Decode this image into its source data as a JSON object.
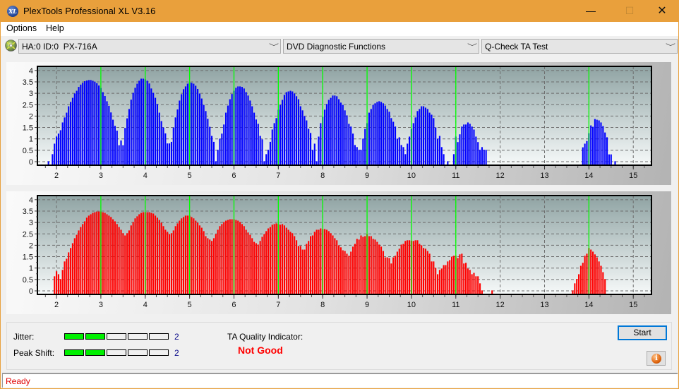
{
  "window": {
    "title": "PlexTools Professional XL V3.16",
    "icon_text": "XL",
    "controls": {
      "minimize": "—",
      "maximize": "☐",
      "close": "✕"
    }
  },
  "menu": [
    {
      "label": "Options"
    },
    {
      "label": "Help"
    }
  ],
  "toolbar": {
    "drive": "HA:0 ID:0  PX-716A",
    "function": "DVD Diagnostic Functions",
    "test": "Q-Check TA Test",
    "chevron": "﹀"
  },
  "chart_data": [
    {
      "type": "bar",
      "title": "",
      "color": "#0000ff",
      "marker_color": "#00ff00",
      "xlim": [
        1.57,
        15.41
      ],
      "ylim": [
        -0.155,
        4.18
      ],
      "x_ticks": [
        2,
        3,
        4,
        5,
        6,
        7,
        8,
        9,
        10,
        11,
        12,
        13,
        14,
        15
      ],
      "x_minor_step": 0.25,
      "y_ticks": [
        0,
        0.5,
        1,
        1.5,
        2,
        2.5,
        3,
        3.5,
        4
      ],
      "grid": true,
      "marker_x": [
        3,
        4,
        5,
        6,
        7,
        8,
        9,
        10,
        11,
        14
      ],
      "x_start": 1.8182,
      "x_step": 0.04545,
      "values": [
        0.02,
        0,
        0.33,
        0.79,
        1.1,
        1.23,
        1.38,
        1.72,
        1.94,
        2.15,
        2.43,
        2.62,
        2.8,
        2.99,
        3.11,
        3.28,
        3.38,
        3.46,
        3.53,
        3.56,
        3.58,
        3.58,
        3.55,
        3.51,
        3.44,
        3.34,
        3.23,
        3.05,
        2.88,
        2.65,
        2.45,
        2.16,
        1.84,
        1.57,
        1.36,
        0.72,
        0.93,
        0.72,
        1.48,
        1.9,
        2.31,
        2.72,
        3.02,
        3.24,
        3.42,
        3.55,
        3.64,
        3.64,
        3.61,
        3.55,
        3.43,
        3.21,
        3.02,
        2.8,
        2.53,
        2.15,
        1.78,
        1.5,
        1.24,
        0.8,
        0.8,
        0.87,
        1.5,
        1.94,
        2.29,
        2.68,
        2.96,
        3.18,
        3.3,
        3.42,
        3.48,
        3.46,
        3.42,
        3.33,
        3.19,
        2.99,
        2.77,
        2.49,
        2.22,
        1.88,
        1.53,
        1.13,
        0.87,
        0.02,
        0.52,
        1.01,
        1.23,
        1.63,
        2.15,
        2.46,
        2.74,
        2.97,
        3.11,
        3.24,
        3.3,
        3.3,
        3.28,
        3.21,
        3.05,
        2.9,
        2.68,
        2.43,
        2.15,
        1.85,
        1.66,
        1.13,
        0.98,
        0.02,
        0.33,
        0.52,
        0.87,
        1.41,
        1.69,
        1.91,
        2.28,
        2.49,
        2.71,
        2.93,
        3.05,
        3.08,
        3.11,
        3.08,
        2.99,
        2.87,
        2.74,
        2.43,
        2.25,
        2.0,
        1.81,
        1.44,
        1.26,
        0.52,
        0.79,
        0.02,
        1.1,
        1.69,
        1.97,
        2.28,
        2.53,
        2.71,
        2.8,
        2.9,
        2.9,
        2.87,
        2.74,
        2.59,
        2.49,
        2.25,
        2.03,
        1.66,
        1.54,
        1.23,
        0.73,
        0.64,
        0.52,
        0.52,
        1.01,
        1.44,
        1.69,
        2.15,
        2.31,
        2.49,
        2.56,
        2.62,
        2.65,
        2.62,
        2.56,
        2.46,
        2.31,
        2.19,
        1.91,
        1.75,
        1.54,
        1.01,
        1.07,
        0.73,
        0.64,
        0.33,
        0.79,
        1.1,
        1.44,
        1.69,
        1.94,
        2.22,
        2.31,
        2.43,
        2.43,
        2.37,
        2.31,
        2.15,
        2.06,
        1.91,
        1.5,
        1.01,
        1.13,
        0.64,
        0.33,
        0,
        0.02,
        0,
        0,
        0.33,
        1.1,
        0.86,
        1.2,
        1.54,
        1.63,
        1.63,
        1.72,
        1.66,
        1.54,
        1.41,
        1.1,
        0.86,
        0.52,
        0.64,
        0.52,
        0.52,
        0,
        0,
        0,
        0,
        0,
        0,
        0,
        0,
        0,
        0,
        0,
        0,
        0,
        0,
        0,
        0,
        0,
        0,
        0,
        0,
        0,
        0,
        0,
        0,
        0,
        0,
        0,
        0,
        0,
        0,
        0,
        0,
        0,
        0,
        0,
        0,
        0,
        0,
        0,
        0,
        0,
        0,
        0,
        0,
        0,
        0,
        0,
        0.63,
        0.79,
        0.91,
        1.25,
        1.59,
        1.53,
        1.87,
        1.84,
        1.81,
        1.72,
        1.56,
        1.28,
        1.07,
        0.32,
        0.32,
        0,
        0.02
      ]
    },
    {
      "type": "bar",
      "title": "",
      "color": "#ff0000",
      "marker_color": "#00ff00",
      "xlim": [
        1.57,
        15.41
      ],
      "ylim": [
        -0.155,
        4.18
      ],
      "x_ticks": [
        2,
        3,
        4,
        5,
        6,
        7,
        8,
        9,
        10,
        11,
        12,
        13,
        14,
        15
      ],
      "x_minor_step": 0.25,
      "y_ticks": [
        0,
        0.5,
        1,
        1.5,
        2,
        2.5,
        3,
        3.5,
        4
      ],
      "grid": true,
      "marker_x": [
        3,
        4,
        5,
        6,
        7,
        8,
        9,
        10,
        11,
        14
      ],
      "x_start": 1.8182,
      "x_step": 0.04545,
      "values": [
        0,
        0,
        0,
        0.64,
        0.86,
        0.73,
        0.52,
        0.92,
        1.29,
        1.41,
        1.69,
        1.88,
        2.09,
        2.31,
        2.46,
        2.65,
        2.8,
        2.93,
        3.05,
        3.21,
        3.3,
        3.36,
        3.42,
        3.45,
        3.48,
        3.48,
        3.48,
        3.45,
        3.42,
        3.36,
        3.3,
        3.24,
        3.14,
        3.05,
        2.93,
        2.8,
        2.68,
        2.53,
        2.43,
        2.53,
        2.65,
        2.87,
        3.02,
        3.18,
        3.27,
        3.36,
        3.42,
        3.45,
        3.45,
        3.45,
        3.45,
        3.42,
        3.39,
        3.3,
        3.21,
        3.11,
        2.99,
        2.84,
        2.68,
        2.59,
        2.49,
        2.53,
        2.65,
        2.84,
        2.96,
        3.08,
        3.18,
        3.24,
        3.3,
        3.3,
        3.3,
        3.24,
        3.18,
        3.08,
        2.99,
        2.87,
        2.77,
        2.62,
        2.4,
        2.31,
        2.25,
        2.19,
        2.31,
        2.49,
        2.68,
        2.84,
        2.93,
        3.02,
        3.08,
        3.11,
        3.14,
        3.14,
        3.14,
        3.11,
        3.08,
        3.02,
        2.93,
        2.84,
        2.68,
        2.56,
        2.46,
        2.31,
        2.15,
        2.09,
        2.03,
        2.19,
        2.37,
        2.49,
        2.62,
        2.74,
        2.8,
        2.9,
        2.93,
        2.96,
        2.93,
        2.9,
        2.93,
        2.87,
        2.77,
        2.68,
        2.59,
        2.53,
        2.4,
        2.22,
        1.97,
        1.97,
        1.81,
        1.81,
        2.06,
        2.19,
        2.4,
        2.43,
        2.59,
        2.68,
        2.68,
        2.74,
        2.71,
        2.71,
        2.68,
        2.62,
        2.53,
        2.43,
        2.31,
        2.22,
        2.0,
        1.91,
        1.78,
        1.75,
        1.63,
        1.54,
        1.72,
        1.94,
        2.06,
        2.28,
        2.25,
        2.43,
        2.37,
        2.4,
        2.49,
        2.4,
        2.4,
        2.28,
        2.25,
        2.15,
        2.03,
        1.94,
        1.75,
        1.47,
        1.47,
        1.44,
        1.2,
        1.47,
        1.54,
        1.72,
        1.85,
        2.03,
        2.06,
        2.19,
        2.22,
        2.22,
        2.2,
        2.19,
        2.22,
        2.22,
        2.06,
        2.0,
        1.88,
        1.85,
        1.75,
        1.63,
        1.29,
        1.29,
        1.01,
        0.73,
        0.92,
        0.98,
        1.13,
        1.13,
        1.29,
        1.35,
        1.5,
        1.54,
        1.54,
        1.44,
        1.6,
        1.63,
        1.2,
        1.23,
        0.98,
        0.92,
        0.73,
        0.79,
        0.64,
        0.64,
        0.33,
        0.02,
        0,
        0,
        0,
        0,
        0.02,
        0,
        0,
        0,
        0,
        0,
        0,
        0,
        0,
        0,
        0,
        0,
        0,
        0,
        0,
        0,
        0,
        0,
        0,
        0,
        0,
        0,
        0,
        0,
        0,
        0,
        0,
        0,
        0,
        0,
        0,
        0,
        0,
        0,
        0,
        0,
        0,
        0,
        0,
        0,
        0.02,
        0.33,
        0.52,
        0.73,
        1.1,
        1.23,
        1.54,
        1.63,
        1.88,
        1.81,
        1.72,
        1.6,
        1.47,
        1.29,
        1.1,
        0.82,
        0.52
      ]
    }
  ],
  "results": {
    "jitter": {
      "label": "Jitter:",
      "value": "2",
      "filled": 2,
      "segments": 5
    },
    "peak_shift": {
      "label": "Peak Shift:",
      "value": "2",
      "filled": 2,
      "segments": 5
    },
    "ta_quality_label": "TA Quality Indicator:",
    "ta_quality_value": "Not Good",
    "status_color": "#ff0000"
  },
  "buttons": {
    "start": "Start",
    "info_icon": "i"
  },
  "status": {
    "text": "Ready"
  }
}
